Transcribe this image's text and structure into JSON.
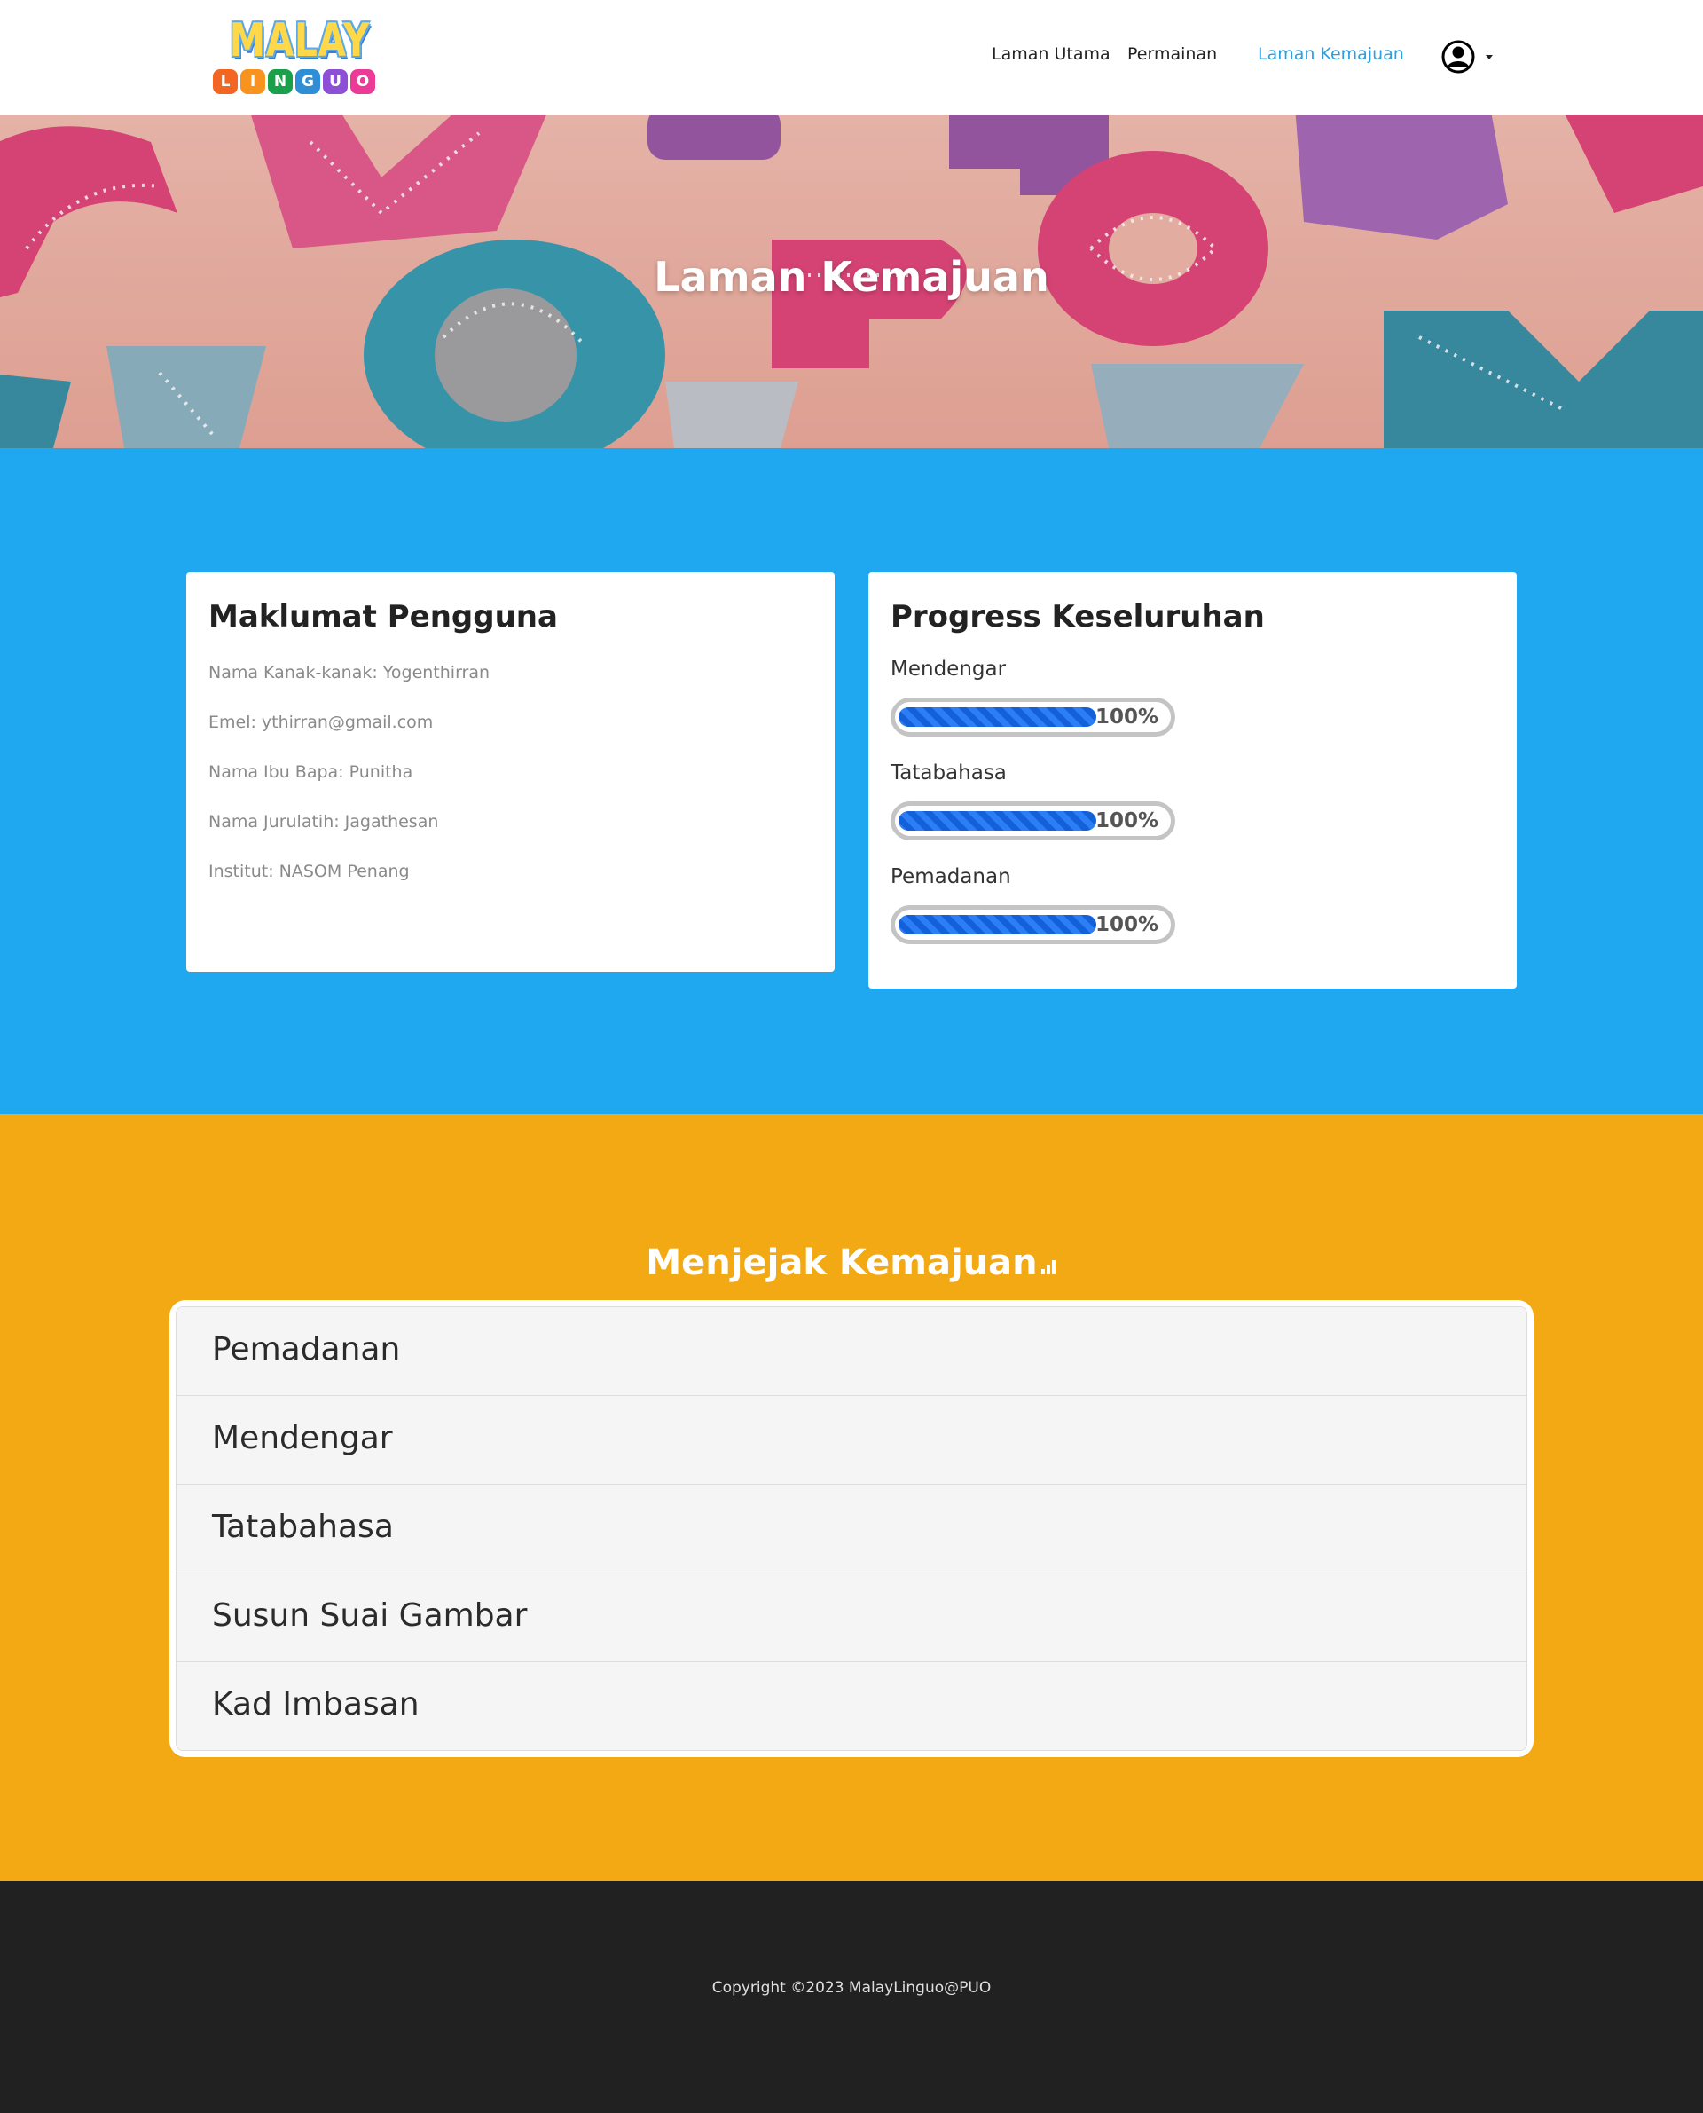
{
  "logo": {
    "top_text": "MALAY",
    "letters": [
      "L",
      "I",
      "N",
      "G",
      "U",
      "O"
    ],
    "letter_colors": [
      "#f26522",
      "#f7931e",
      "#1aa04a",
      "#2e8fd6",
      "#8c4fd6",
      "#ec3b96"
    ]
  },
  "nav": {
    "links": [
      "Laman Utama",
      "Permainan",
      "Laman Kemajuan"
    ],
    "active_index": 2,
    "user_icon": "user-circle-icon"
  },
  "hero": {
    "title": "Laman Kemajuan"
  },
  "user_info": {
    "title": "Maklumat Pengguna",
    "lines": [
      "Nama Kanak-kanak: Yogenthirran",
      "Emel: ythirran@gmail.com",
      "Nama Ibu Bapa: Punitha",
      "Nama Jurulatih: Jagathesan",
      "Institut: NASOM Penang"
    ]
  },
  "progress": {
    "title": "Progress Keseluruhan",
    "items": [
      {
        "label": "Mendengar",
        "value_text": "100%",
        "fraction": 1.0
      },
      {
        "label": "Tatabahasa",
        "value_text": "100%",
        "fraction": 1.0
      },
      {
        "label": "Pemadanan",
        "value_text": "100%",
        "fraction": 1.0
      }
    ]
  },
  "tracking": {
    "title": "Menjejak Kemajuan",
    "icon": "bar-chart-icon",
    "items": [
      "Pemadanan",
      "Mendengar",
      "Tatabahasa",
      "Susun Suai Gambar",
      "Kad Imbasan"
    ]
  },
  "footer": {
    "copyright": "Copyright ©2023 MalayLinguo@PUO"
  },
  "colors": {
    "blue_section": "#1fa8ef",
    "orange_section": "#f2a913",
    "footer": "#212121",
    "nav_active": "#2d9fe0",
    "progress_fill": "#2b7ef5"
  }
}
